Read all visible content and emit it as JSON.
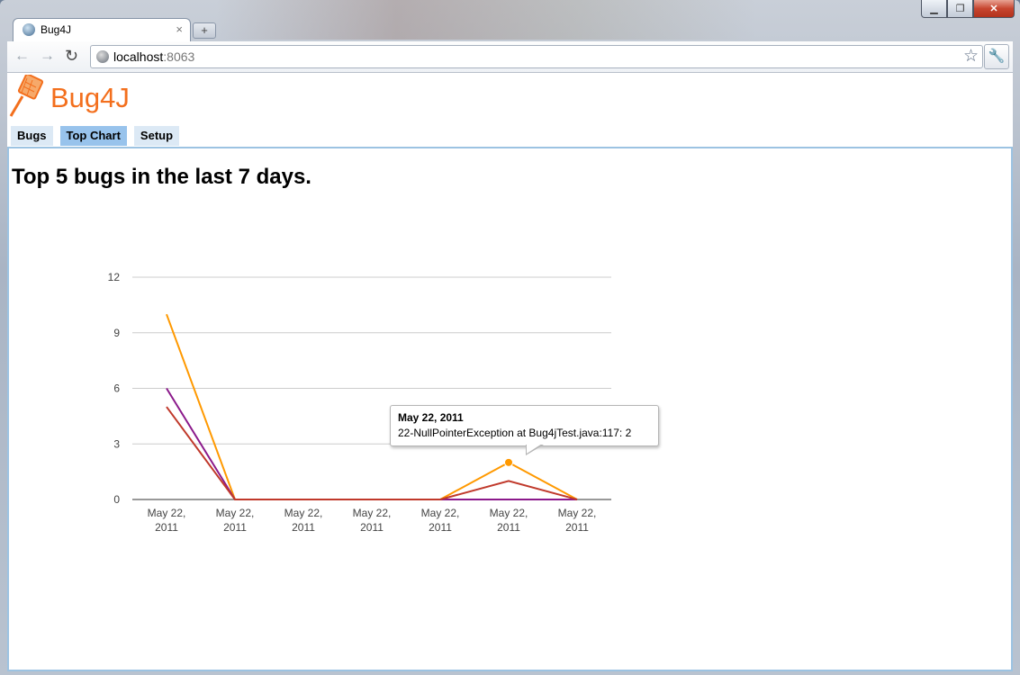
{
  "browser": {
    "tab_title": "Bug4J",
    "tab_close": "×",
    "new_tab": "+",
    "url_host": "localhost",
    "url_port": ":8063"
  },
  "app": {
    "brand": "Bug4J",
    "nav": [
      "Bugs",
      "Top Chart",
      "Setup"
    ],
    "active_nav": "Top Chart"
  },
  "main": {
    "heading": "Top 5 bugs in the last 7 days."
  },
  "chart_data": {
    "type": "line",
    "title": "",
    "xlabel": "",
    "ylabel": "",
    "ylim": [
      0,
      12
    ],
    "yticks": [
      0,
      3,
      6,
      9,
      12
    ],
    "categories": [
      "May 22, 2011",
      "May 22, 2011",
      "May 22, 2011",
      "May 22, 2011",
      "May 22, 2011",
      "May 22, 2011",
      "May 22, 2011"
    ],
    "grid": true,
    "series": [
      {
        "color": "#ff9900",
        "values": [
          10,
          0,
          0,
          0,
          0,
          2,
          0
        ]
      },
      {
        "color": "#8b1a8b",
        "values": [
          6,
          0,
          0,
          0,
          0,
          0,
          0
        ]
      },
      {
        "color": "#c0392b",
        "values": [
          5,
          0,
          0,
          0,
          0,
          1,
          0
        ]
      }
    ],
    "tooltip": {
      "title": "May 22, 2011",
      "body": "22-NullPointerException at Bug4jTest.java:117: 2"
    }
  }
}
